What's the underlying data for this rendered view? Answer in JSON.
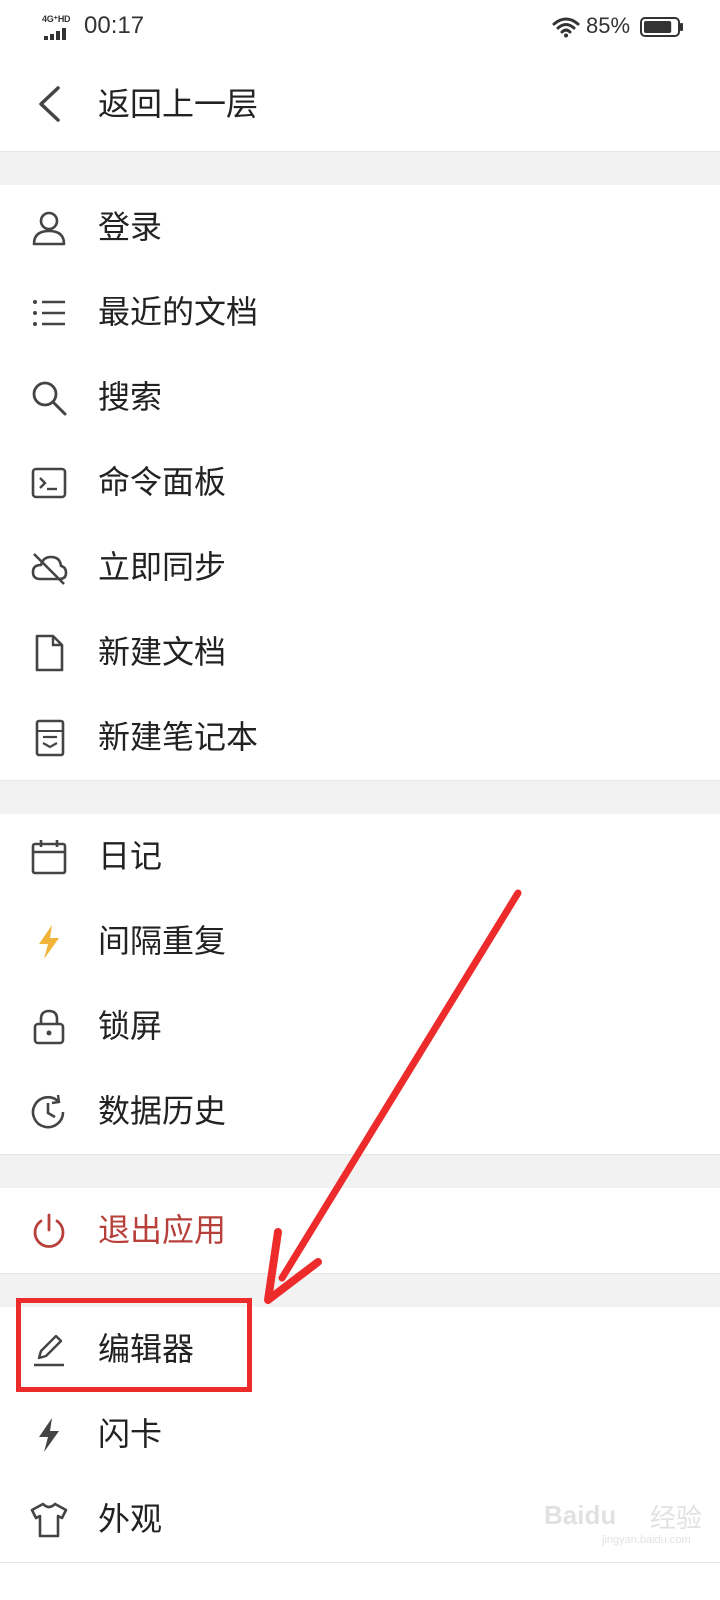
{
  "status_bar": {
    "network": "4G⁺HD",
    "time": "00:17",
    "battery_percent": "85%",
    "battery_level": 0.85
  },
  "header": {
    "back_icon": "chevron-left-icon",
    "title": "返回上一层"
  },
  "menu": {
    "group1": [
      {
        "label": "登录",
        "icon": "user-icon"
      },
      {
        "label": "最近的文档",
        "icon": "list-icon"
      },
      {
        "label": "搜索",
        "icon": "search-icon"
      },
      {
        "label": "命令面板",
        "icon": "terminal-icon"
      },
      {
        "label": "立即同步",
        "icon": "cloud-off-icon"
      },
      {
        "label": "新建文档",
        "icon": "file-icon"
      },
      {
        "label": "新建笔记本",
        "icon": "notebook-icon"
      }
    ],
    "group2": [
      {
        "label": "日记",
        "icon": "calendar-icon"
      },
      {
        "label": "间隔重复",
        "icon": "lightning-icon",
        "icon_color": "#f0b43a"
      },
      {
        "label": "锁屏",
        "icon": "lock-icon"
      },
      {
        "label": "数据历史",
        "icon": "history-icon"
      }
    ],
    "group3": [
      {
        "label": "退出应用",
        "icon": "power-icon",
        "color": "#b8403a"
      }
    ],
    "group4": [
      {
        "label": "编辑器",
        "icon": "pencil-icon"
      },
      {
        "label": "闪卡",
        "icon": "lightning-icon"
      },
      {
        "label": "外观",
        "icon": "tshirt-icon"
      }
    ]
  },
  "annotation": {
    "highlight_color": "#ee2b2b"
  },
  "watermark": {
    "brand": "Baidu",
    "brand_cn": "经验",
    "url": "jingyan.baidu.com"
  }
}
